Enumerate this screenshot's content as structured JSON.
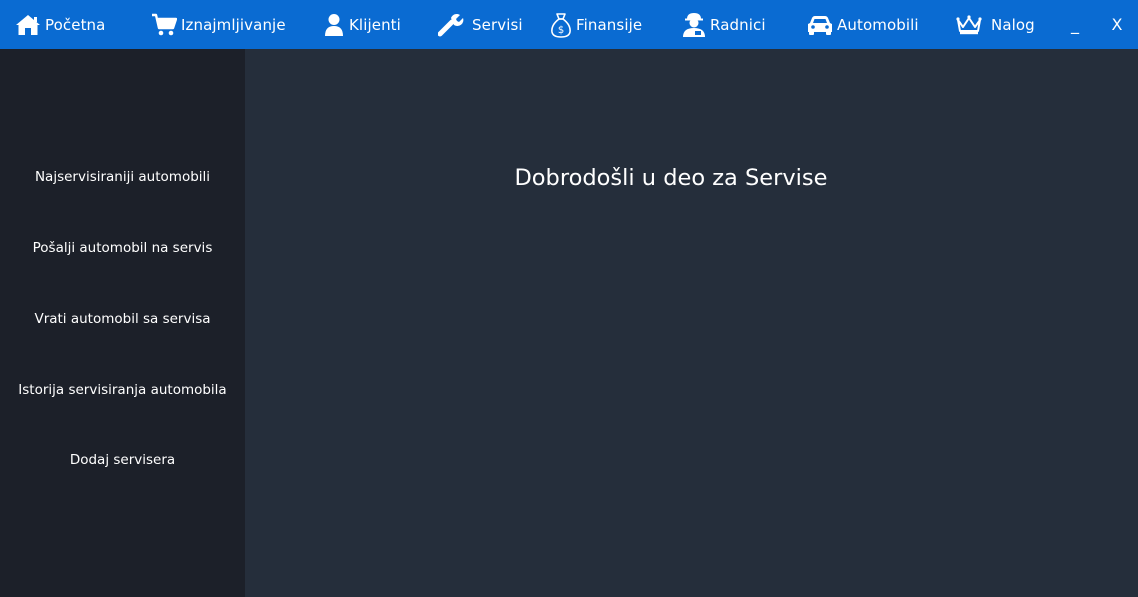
{
  "nav": {
    "items": [
      {
        "label": "Početna",
        "icon": "home-icon"
      },
      {
        "label": "Iznajmljivanje",
        "icon": "cart-icon"
      },
      {
        "label": "Klijenti",
        "icon": "user-icon"
      },
      {
        "label": "Servisi",
        "icon": "wrench-icon"
      },
      {
        "label": "Finansije",
        "icon": "money-bag-icon"
      },
      {
        "label": "Radnici",
        "icon": "worker-icon"
      },
      {
        "label": "Automobili",
        "icon": "car-icon"
      },
      {
        "label": "Nalog",
        "icon": "crown-icon"
      }
    ],
    "minimize_label": "_",
    "close_label": "X"
  },
  "sidebar": {
    "items": [
      {
        "label": "Najservisiraniji automobili"
      },
      {
        "label": "Pošalji automobil na servis"
      },
      {
        "label": "Vrati automobil sa servisa"
      },
      {
        "label": "Istorija servisiranja automobila"
      },
      {
        "label": "Dodaj servisera"
      }
    ]
  },
  "main": {
    "welcome_text": "Dobrodošli u deo za Servise"
  },
  "colors": {
    "topbar": "#0a6bd2",
    "sidebar": "#1c2029",
    "main": "#252e3b",
    "text": "#ffffff"
  }
}
